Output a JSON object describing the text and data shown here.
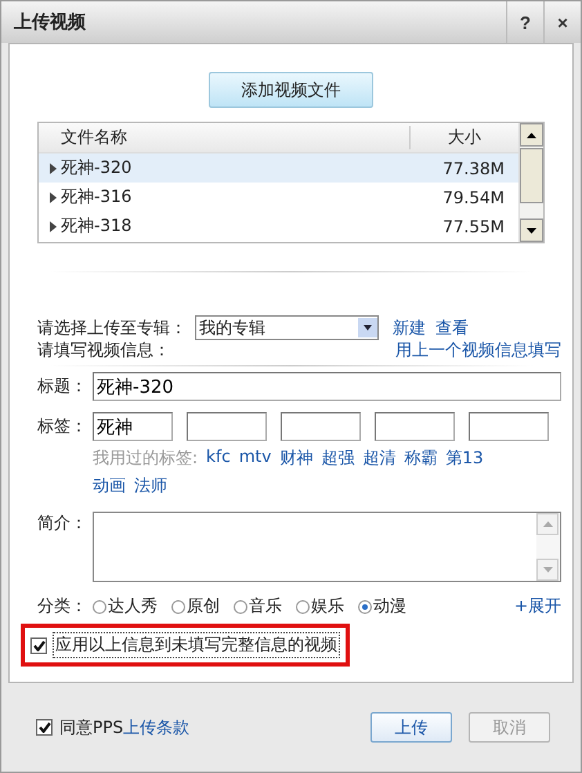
{
  "window": {
    "title": "上传视频",
    "help": "?",
    "close": "×"
  },
  "add_button": "添加视频文件",
  "file_table": {
    "columns": [
      "文件名称",
      "大小"
    ],
    "rows": [
      {
        "name": "死神-320",
        "size": "77.38M",
        "selected": true
      },
      {
        "name": "死神-316",
        "size": "79.54M",
        "selected": false
      },
      {
        "name": "死神-318",
        "size": "77.55M",
        "selected": false
      }
    ]
  },
  "album": {
    "label": "请选择上传至专辑：",
    "value": "我的专辑",
    "links": [
      "新建",
      "查看"
    ]
  },
  "info": {
    "heading": "请填写视频信息：",
    "fill_link": "用上一个视频信息填写",
    "title_label": "标题：",
    "title_value": "死神-320",
    "tags_label": "标签：",
    "tag_fields": [
      {
        "kind": "filled",
        "value": "死神"
      },
      {
        "kind": "empty"
      },
      {
        "kind": "empty"
      },
      {
        "kind": "empty"
      },
      {
        "kind": "empty"
      }
    ],
    "used_tags_label": "我用过的标签:",
    "used_tags": [
      "kfc",
      "mtv",
      "财神",
      "超强",
      "超清",
      "称霸",
      "第13",
      "动画",
      "法师"
    ],
    "description_label": "简介：",
    "category_label": "分类：",
    "categories": [
      {
        "label": "达人秀",
        "selected": false
      },
      {
        "label": "原创",
        "selected": false
      },
      {
        "label": "音乐",
        "selected": false
      },
      {
        "label": "娱乐",
        "selected": false
      },
      {
        "label": "动漫",
        "selected": true
      }
    ],
    "expand_link": "+展开"
  },
  "apply_all": {
    "label": "应用以上信息到未填写完整信息的视频",
    "checked": true,
    "highlighted": true
  },
  "footer": {
    "agree": {
      "label": "同意PPS",
      "link": "上传条款",
      "checked": true
    },
    "buttons": [
      {
        "label": "上传",
        "disabled": false
      },
      {
        "label": "取消",
        "disabled": true
      }
    ]
  }
}
